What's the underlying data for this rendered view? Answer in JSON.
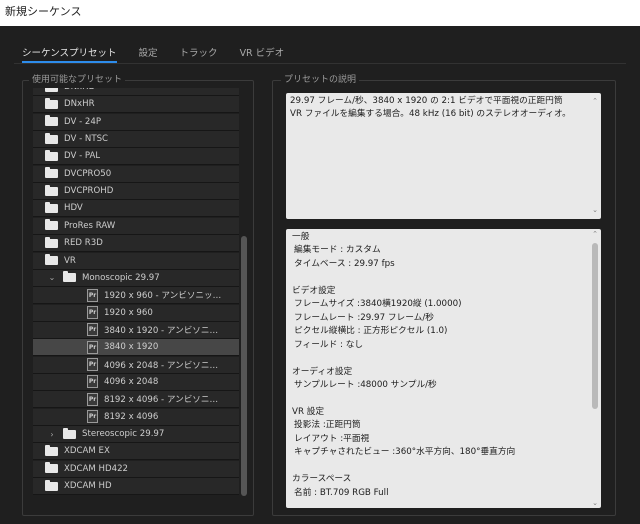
{
  "window": {
    "title": "新規シーケンス"
  },
  "tabs": [
    {
      "label": "シーケンスプリセット"
    },
    {
      "label": "設定"
    },
    {
      "label": "トラック"
    },
    {
      "label": "VR ビデオ"
    }
  ],
  "left": {
    "legend": "使用可能なプリセット",
    "tree": [
      {
        "label": "DNxHD",
        "type": "folder",
        "depth": 0
      },
      {
        "label": "DNxHR",
        "type": "folder",
        "depth": 0
      },
      {
        "label": "DV - 24P",
        "type": "folder",
        "depth": 0
      },
      {
        "label": "DV - NTSC",
        "type": "folder",
        "depth": 0
      },
      {
        "label": "DV - PAL",
        "type": "folder",
        "depth": 0
      },
      {
        "label": "DVCPRO50",
        "type": "folder",
        "depth": 0
      },
      {
        "label": "DVCPROHD",
        "type": "folder",
        "depth": 0
      },
      {
        "label": "HDV",
        "type": "folder",
        "depth": 0
      },
      {
        "label": "ProRes RAW",
        "type": "folder",
        "depth": 0
      },
      {
        "label": "RED R3D",
        "type": "folder",
        "depth": 0
      },
      {
        "label": "VR",
        "type": "folder",
        "depth": 0
      },
      {
        "label": "Monoscopic 29.97",
        "type": "folder",
        "depth": 1,
        "chevron": "v"
      },
      {
        "label": "1920 x 960 - アンビソニッ…",
        "type": "preset",
        "depth": 2
      },
      {
        "label": "1920 x 960",
        "type": "preset",
        "depth": 2
      },
      {
        "label": "3840 x 1920 - アンビソニ…",
        "type": "preset",
        "depth": 2
      },
      {
        "label": "3840 x 1920",
        "type": "preset",
        "depth": 2,
        "selected": true
      },
      {
        "label": "4096 x 2048 - アンビソニ…",
        "type": "preset",
        "depth": 2
      },
      {
        "label": "4096 x 2048",
        "type": "preset",
        "depth": 2
      },
      {
        "label": "8192 x 4096 - アンビソニ…",
        "type": "preset",
        "depth": 2
      },
      {
        "label": "8192 x 4096",
        "type": "preset",
        "depth": 2
      },
      {
        "label": "Stereoscopic 29.97",
        "type": "folder",
        "depth": 1,
        "chevron": ">"
      },
      {
        "label": "XDCAM EX",
        "type": "folder",
        "depth": 0
      },
      {
        "label": "XDCAM HD422",
        "type": "folder",
        "depth": 0
      },
      {
        "label": "XDCAM HD",
        "type": "folder",
        "depth": 0
      }
    ]
  },
  "right": {
    "legend": "プリセットの説明",
    "description": [
      "29.97 フレーム/秒、3840 x 1920 の 2:1 ビデオで平面視の正距円筒",
      "VR ファイルを編集する場合。48 kHz (16 bit) のステレオオーディオ。"
    ],
    "info": [
      {
        "text": "一般",
        "sub": false
      },
      {
        "text": "編集モード : カスタム",
        "sub": true
      },
      {
        "text": "タイムベース : 29.97 fps",
        "sub": true
      },
      {
        "text": "",
        "sub": false
      },
      {
        "text": "ビデオ設定",
        "sub": false
      },
      {
        "text": "フレームサイズ :3840横1920縦 (1.0000)",
        "sub": true
      },
      {
        "text": "フレームレート :29.97 フレーム/秒",
        "sub": true
      },
      {
        "text": "ピクセル縦横比 : 正方形ピクセル (1.0)",
        "sub": true
      },
      {
        "text": "フィールド : なし",
        "sub": true
      },
      {
        "text": "",
        "sub": false
      },
      {
        "text": "オーディオ設定",
        "sub": false
      },
      {
        "text": "サンプルレート :48000 サンプル/秒",
        "sub": true
      },
      {
        "text": "",
        "sub": false
      },
      {
        "text": "VR 設定",
        "sub": false
      },
      {
        "text": "投影法 :正距円筒",
        "sub": true
      },
      {
        "text": "レイアウト :平面視",
        "sub": true
      },
      {
        "text": "キャプチャされたビュー :360°水平方向、180°垂直方向",
        "sub": true
      },
      {
        "text": "",
        "sub": false
      },
      {
        "text": "カラースペース",
        "sub": false
      },
      {
        "text": "名前 : BT.709 RGB Full",
        "sub": true
      }
    ]
  },
  "icons": {
    "folder": "folder-icon",
    "preset": "premiere-preset-icon",
    "expanded": "chevron-down-icon",
    "collapsed": "chevron-right-icon"
  },
  "colors": {
    "accent": "#2d8ceb",
    "background": "#1f1f1f",
    "selected_row": "#474747"
  }
}
